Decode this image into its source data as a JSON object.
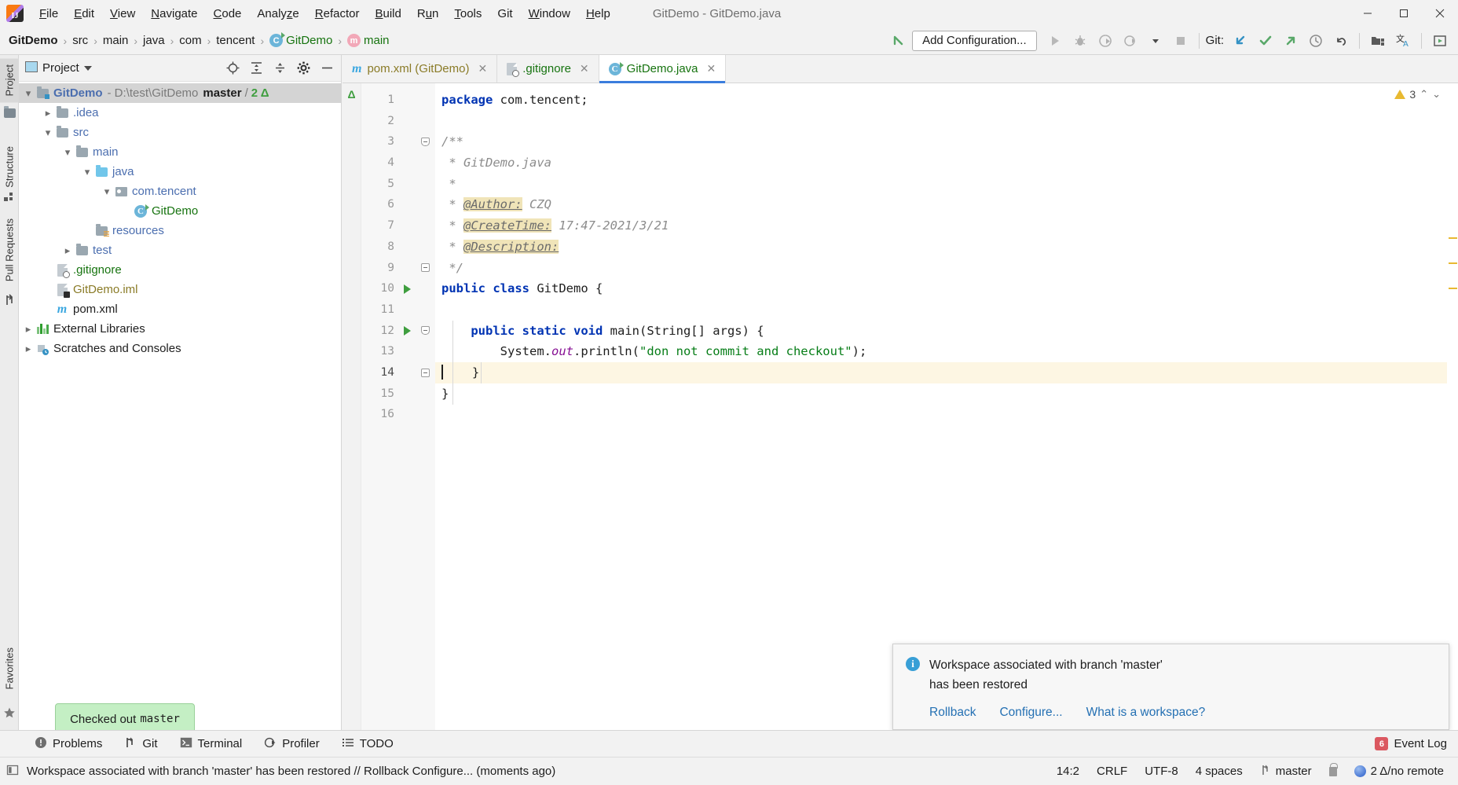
{
  "window": {
    "title": "GitDemo - GitDemo.java",
    "logo_text": "IJ",
    "controls": {
      "minimize": "─",
      "maximize": "☐",
      "close": "✕"
    }
  },
  "menubar": {
    "items": [
      {
        "label": "File",
        "mnemonic": "F"
      },
      {
        "label": "Edit",
        "mnemonic": "E"
      },
      {
        "label": "View",
        "mnemonic": "V"
      },
      {
        "label": "Navigate",
        "mnemonic": "N"
      },
      {
        "label": "Code",
        "mnemonic": "C"
      },
      {
        "label": "Analyze",
        "mnemonic": "z"
      },
      {
        "label": "Refactor",
        "mnemonic": "R"
      },
      {
        "label": "Build",
        "mnemonic": "B"
      },
      {
        "label": "Run",
        "mnemonic": "u"
      },
      {
        "label": "Tools",
        "mnemonic": "T"
      },
      {
        "label": "Git",
        "mnemonic": ""
      },
      {
        "label": "Window",
        "mnemonic": "W"
      },
      {
        "label": "Help",
        "mnemonic": "H"
      }
    ]
  },
  "navbar": {
    "breadcrumbs": [
      {
        "label": "GitDemo",
        "style": "bold"
      },
      {
        "label": "src",
        "style": "plain"
      },
      {
        "label": "main",
        "style": "plain"
      },
      {
        "label": "java",
        "style": "plain"
      },
      {
        "label": "com",
        "style": "plain"
      },
      {
        "label": "tencent",
        "style": "plain"
      },
      {
        "label": "GitDemo",
        "style": "class"
      },
      {
        "label": "main",
        "style": "method"
      }
    ],
    "separator": "›",
    "add_configuration": "Add Configuration...",
    "git_label": "Git:",
    "icons": [
      "back-arrow-icon",
      "run-icon",
      "debug-icon",
      "run-with-coverage-icon",
      "profile-icon",
      "dropdown-icon",
      "stop-icon",
      "git-update-icon",
      "git-commit-icon",
      "git-push-icon",
      "git-history-icon",
      "git-rollback-icon",
      "project-structure-icon",
      "translate-icon",
      "run-anything-icon"
    ]
  },
  "left_strip": {
    "tabs": [
      {
        "label": "Project",
        "active": true
      },
      {
        "label": "Structure",
        "active": false
      },
      {
        "label": "Pull Requests",
        "active": false
      }
    ],
    "bottom_tabs": [
      {
        "label": "Favorites",
        "active": false
      }
    ]
  },
  "project_panel": {
    "title": "Project",
    "actions": [
      "locate-icon",
      "expand-all-icon",
      "collapse-all-icon",
      "settings-icon",
      "hide-icon"
    ],
    "tree": [
      {
        "depth": 0,
        "label": "GitDemo",
        "kind": "project",
        "arrow": "expanded",
        "selected": true,
        "path": "- D:\\test\\GitDemo",
        "branch": "master",
        "slash": "/",
        "delta": "2 Δ"
      },
      {
        "depth": 1,
        "label": ".idea",
        "kind": "folder",
        "arrow": "collapsed"
      },
      {
        "depth": 1,
        "label": "src",
        "kind": "folder",
        "arrow": "expanded"
      },
      {
        "depth": 2,
        "label": "main",
        "kind": "folder",
        "arrow": "expanded"
      },
      {
        "depth": 3,
        "label": "java",
        "kind": "source-folder",
        "arrow": "expanded"
      },
      {
        "depth": 4,
        "label": "com.tencent",
        "kind": "package",
        "arrow": "expanded"
      },
      {
        "depth": 5,
        "label": "GitDemo",
        "kind": "class",
        "arrow": "none"
      },
      {
        "depth": 3,
        "label": "resources",
        "kind": "resources-folder",
        "arrow": "none"
      },
      {
        "depth": 2,
        "label": "test",
        "kind": "folder",
        "arrow": "collapsed"
      },
      {
        "depth": 1,
        "label": ".gitignore",
        "kind": "gitignore-file",
        "arrow": "none"
      },
      {
        "depth": 1,
        "label": "GitDemo.iml",
        "kind": "iml-file",
        "arrow": "none"
      },
      {
        "depth": 1,
        "label": "pom.xml",
        "kind": "maven-file",
        "arrow": "none"
      },
      {
        "depth": 0,
        "label": "External Libraries",
        "kind": "libraries",
        "arrow": "collapsed"
      },
      {
        "depth": 0,
        "label": "Scratches and Consoles",
        "kind": "scratches",
        "arrow": "collapsed"
      }
    ]
  },
  "editor": {
    "tabs": [
      {
        "label": "pom.xml (GitDemo)",
        "icon": "maven-file-icon",
        "active": false,
        "close": "✕"
      },
      {
        "label": ".gitignore",
        "icon": "gitignore-file-icon",
        "active": false,
        "close": "✕"
      },
      {
        "label": "GitDemo.java",
        "icon": "java-class-icon",
        "active": true,
        "close": "✕"
      }
    ],
    "inspection": {
      "count": "3",
      "up": "⌃",
      "down": "⌄"
    },
    "gutter_delta": "Δ",
    "lines": [
      {
        "n": 1,
        "fold": "none",
        "run": false,
        "highlight": false,
        "tokens": [
          {
            "t": "package ",
            "c": "kw"
          },
          {
            "t": "com.tencent;",
            "c": "plain"
          }
        ]
      },
      {
        "n": 2,
        "fold": "none",
        "run": false,
        "highlight": false,
        "tokens": []
      },
      {
        "n": 3,
        "fold": "open",
        "run": false,
        "highlight": false,
        "tokens": [
          {
            "t": "/**",
            "c": "cmt"
          }
        ]
      },
      {
        "n": 4,
        "fold": "none",
        "run": false,
        "highlight": false,
        "tokens": [
          {
            "t": " * GitDemo.java",
            "c": "cmt"
          }
        ]
      },
      {
        "n": 5,
        "fold": "none",
        "run": false,
        "highlight": false,
        "tokens": [
          {
            "t": " * ",
            "c": "cmt"
          }
        ]
      },
      {
        "n": 6,
        "fold": "none",
        "run": false,
        "highlight": false,
        "tokens": [
          {
            "t": " * ",
            "c": "cmt"
          },
          {
            "t": "@Author:",
            "c": "tag"
          },
          {
            "t": " CZQ",
            "c": "cmt"
          }
        ]
      },
      {
        "n": 7,
        "fold": "none",
        "run": false,
        "highlight": false,
        "tokens": [
          {
            "t": " * ",
            "c": "cmt"
          },
          {
            "t": "@CreateTime:",
            "c": "tag"
          },
          {
            "t": " 17:47-2021/3/21",
            "c": "cmt"
          }
        ]
      },
      {
        "n": 8,
        "fold": "none",
        "run": false,
        "highlight": false,
        "tokens": [
          {
            "t": " * ",
            "c": "cmt"
          },
          {
            "t": "@Description:",
            "c": "tag"
          }
        ]
      },
      {
        "n": 9,
        "fold": "close",
        "run": false,
        "highlight": false,
        "tokens": [
          {
            "t": " */",
            "c": "cmt"
          }
        ]
      },
      {
        "n": 10,
        "fold": "none",
        "run": true,
        "highlight": false,
        "tokens": [
          {
            "t": "public ",
            "c": "kw"
          },
          {
            "t": "class ",
            "c": "kw"
          },
          {
            "t": "GitDemo {",
            "c": "plain"
          }
        ]
      },
      {
        "n": 11,
        "fold": "none",
        "run": false,
        "highlight": false,
        "tokens": []
      },
      {
        "n": 12,
        "fold": "open",
        "run": true,
        "highlight": false,
        "tokens": [
          {
            "t": "    ",
            "c": "plain"
          },
          {
            "t": "public ",
            "c": "kw"
          },
          {
            "t": "static ",
            "c": "kw"
          },
          {
            "t": "void ",
            "c": "kw"
          },
          {
            "t": "main(String[] args) {",
            "c": "plain"
          }
        ]
      },
      {
        "n": 13,
        "fold": "none",
        "run": false,
        "highlight": false,
        "tokens": [
          {
            "t": "        System.",
            "c": "plain"
          },
          {
            "t": "out",
            "c": "fld"
          },
          {
            "t": ".println(",
            "c": "plain"
          },
          {
            "t": "\"don not commit and checkout\"",
            "c": "str"
          },
          {
            "t": ");",
            "c": "plain"
          }
        ]
      },
      {
        "n": 14,
        "fold": "close",
        "run": false,
        "highlight": true,
        "tokens": [
          {
            "t": "    }",
            "c": "plain"
          }
        ],
        "caret": true
      },
      {
        "n": 15,
        "fold": "none",
        "run": false,
        "highlight": false,
        "tokens": [
          {
            "t": "}",
            "c": "plain"
          }
        ]
      },
      {
        "n": 16,
        "fold": "none",
        "run": false,
        "highlight": false,
        "tokens": []
      }
    ]
  },
  "notification": {
    "icon": "info-icon",
    "message_line1": "Workspace associated with branch 'master'",
    "message_line2": "has been restored",
    "links": [
      "Rollback",
      "Configure...",
      "What is a workspace?"
    ]
  },
  "tooltip": {
    "prefix": "Checked out ",
    "branch": "master"
  },
  "bottom_bar": {
    "tabs": [
      {
        "label": "Problems",
        "icon": "problems-icon"
      },
      {
        "label": "Git",
        "icon": "git-branch-icon"
      },
      {
        "label": "Terminal",
        "icon": "terminal-icon"
      },
      {
        "label": "Profiler",
        "icon": "profiler-icon"
      },
      {
        "label": "TODO",
        "icon": "todo-icon"
      }
    ],
    "event_log": {
      "label": "Event Log",
      "badge": "6"
    }
  },
  "statusbar": {
    "icon": "status-toggle-icon",
    "message": "Workspace associated with branch 'master' has been restored // Rollback   Configure... (moments ago)",
    "caret_position": "14:2",
    "line_separator": "CRLF",
    "encoding": "UTF-8",
    "indent": "4 spaces",
    "branch": "master",
    "branch_icon": "git-branch-icon",
    "lock_icon": "lock-icon",
    "remote_status": "2 Δ/no remote"
  },
  "colors": {
    "accent_blue": "#3b7ddd",
    "keyword_blue": "#0033b3",
    "string_green": "#067d17",
    "comment_gray": "#8c8c8c",
    "tag_highlight": "#f0e4b8",
    "tooltip_green": "#c4efc4",
    "warning_yellow": "#e8b931",
    "link_blue": "#2470b3"
  }
}
